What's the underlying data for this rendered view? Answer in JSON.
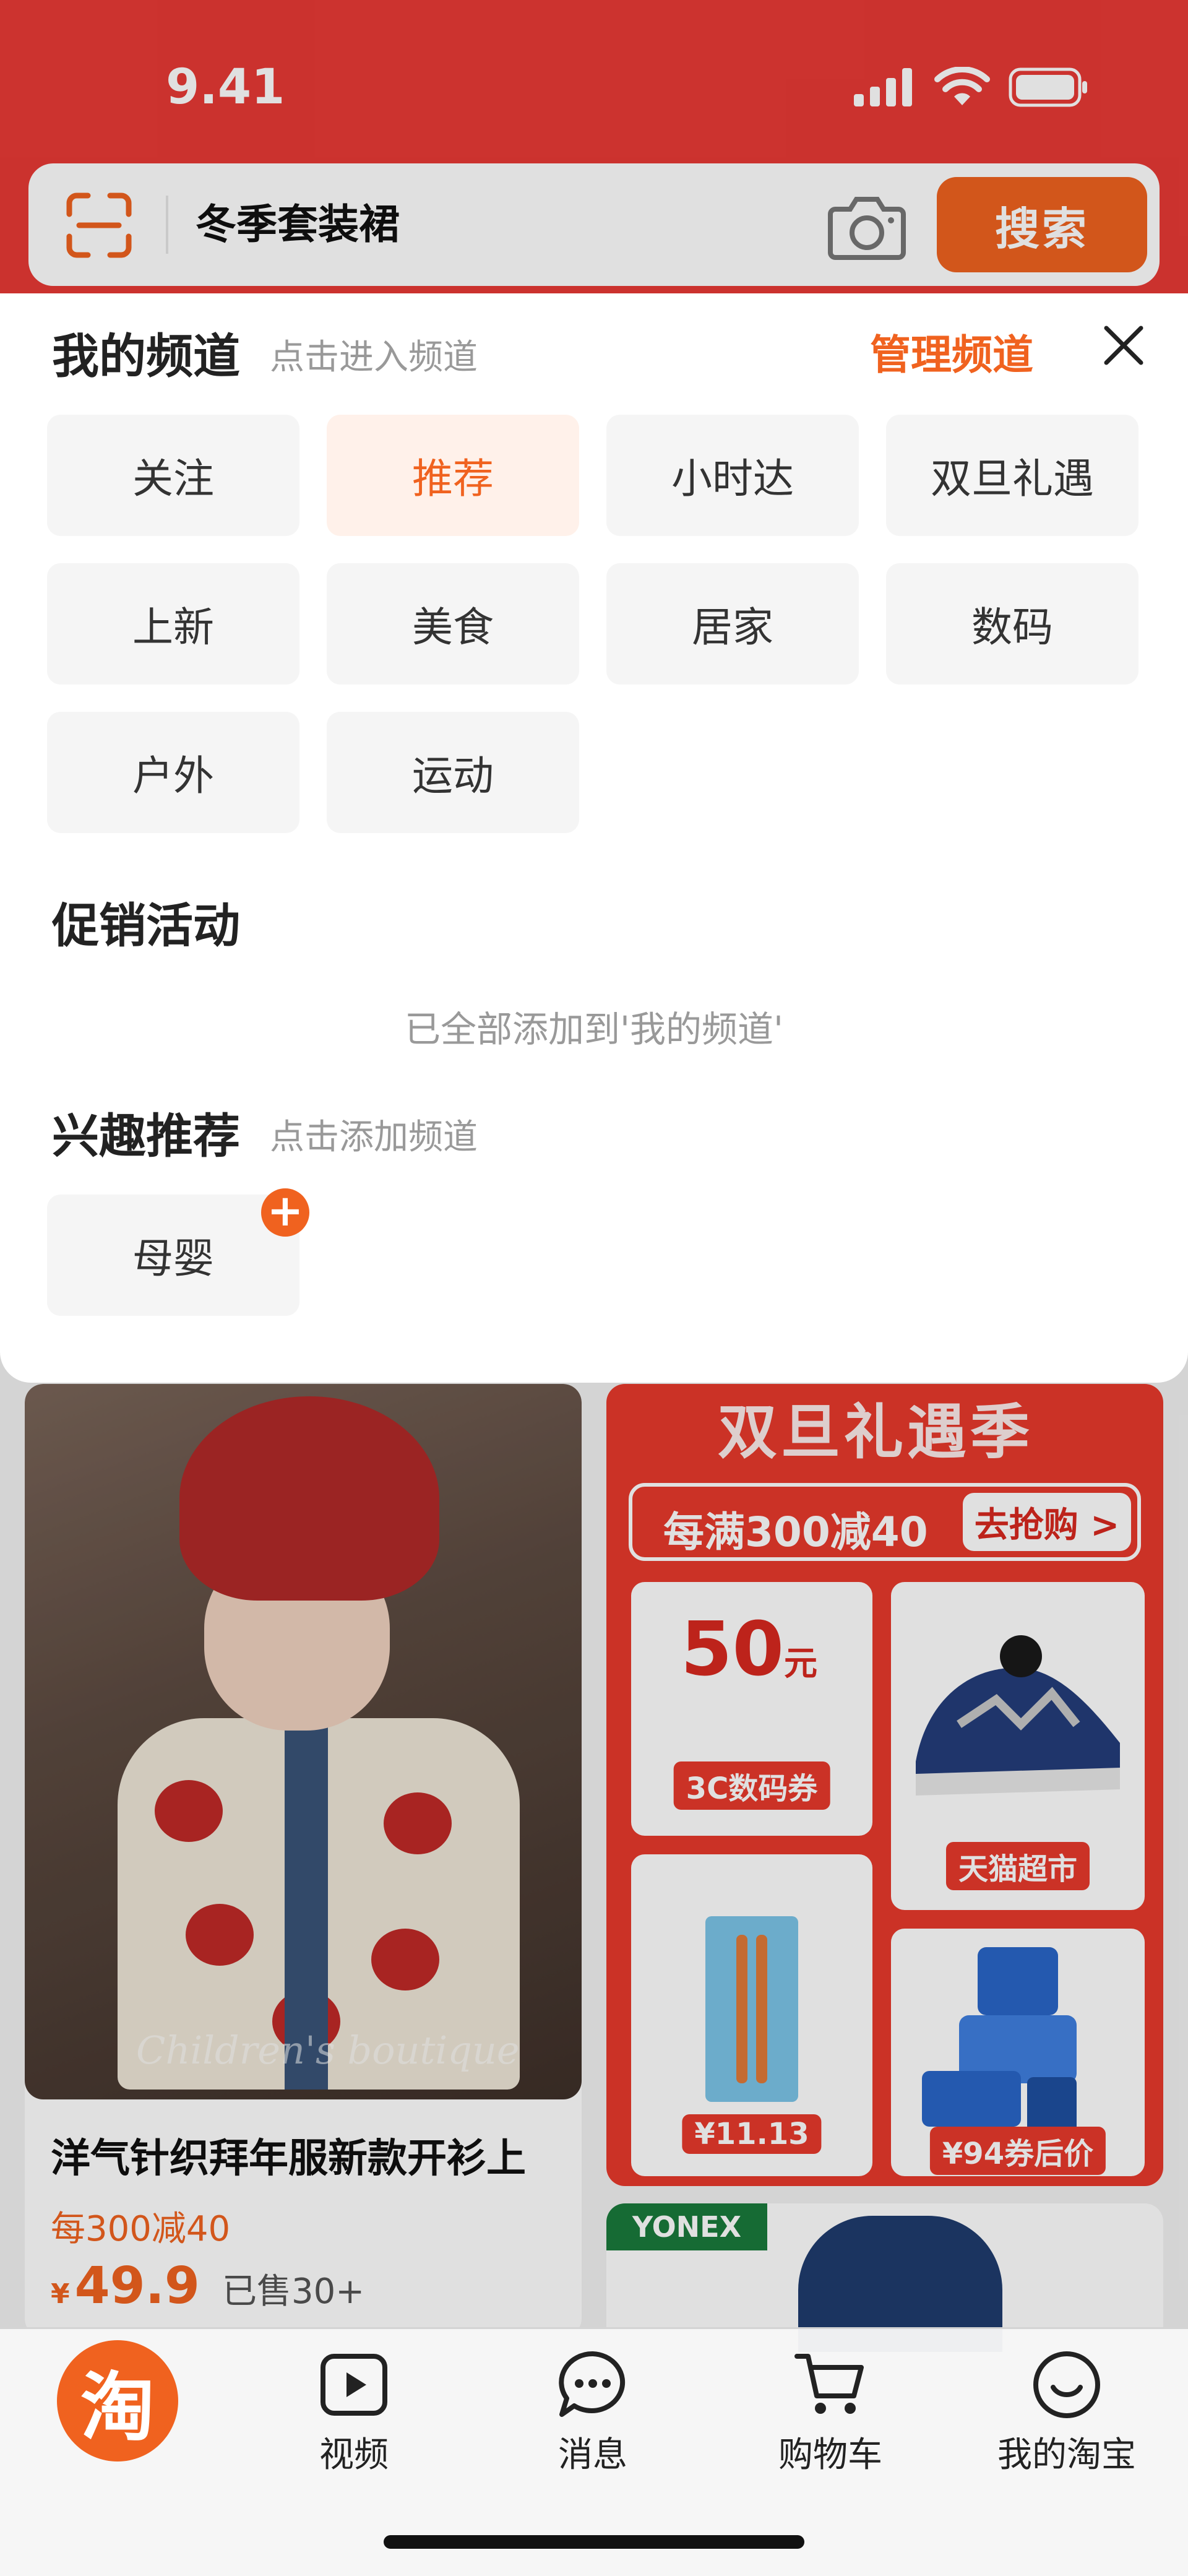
{
  "status_bar": {
    "time": "9.41"
  },
  "search": {
    "query": "冬季套装裙",
    "button_label": "搜索"
  },
  "channels_panel": {
    "my_channels": {
      "title": "我的频道",
      "hint": "点击进入频道",
      "manage_label": "管理频道",
      "items": [
        "关注",
        "推荐",
        "小时达",
        "双旦礼遇",
        "上新",
        "美食",
        "居家",
        "数码",
        "户外",
        "运动"
      ],
      "active": "推荐"
    },
    "promotions": {
      "title": "促销活动",
      "empty_note": "已全部添加到'我的频道'"
    },
    "interests": {
      "title": "兴趣推荐",
      "hint": "点击添加频道",
      "items": [
        "母婴"
      ],
      "add_symbol": "+"
    }
  },
  "feed": {
    "left_card": {
      "watermark": "Children's boutique",
      "title": "洋气针织拜年服新款开衫上",
      "promo": "每300减40",
      "price_symbol": "¥",
      "price": "49.9",
      "sold": "已售30+"
    },
    "right_card": {
      "banner_title": "双旦礼遇季",
      "promo_text": "每满300减40",
      "promo_button": "去抢购 >",
      "coupon_amount": "50",
      "coupon_unit": "元",
      "coupon_tag": "3C数码券",
      "tile2_tag": "天猫超市",
      "tile3_tag": "¥11.13",
      "tile4_tag": "¥94券后价"
    },
    "right_card2": {
      "brand": "YONEX"
    }
  },
  "tab_bar": {
    "home_glyph": "淘",
    "items": [
      {
        "label": "视频",
        "icon": "video-icon"
      },
      {
        "label": "消息",
        "icon": "message-icon"
      },
      {
        "label": "购物车",
        "icon": "cart-icon"
      },
      {
        "label": "我的淘宝",
        "icon": "profile-icon"
      }
    ]
  },
  "colors": {
    "header_red": "#e83a35",
    "accent_orange": "#f0621f",
    "active_chip_bg": "#fff1ea"
  }
}
